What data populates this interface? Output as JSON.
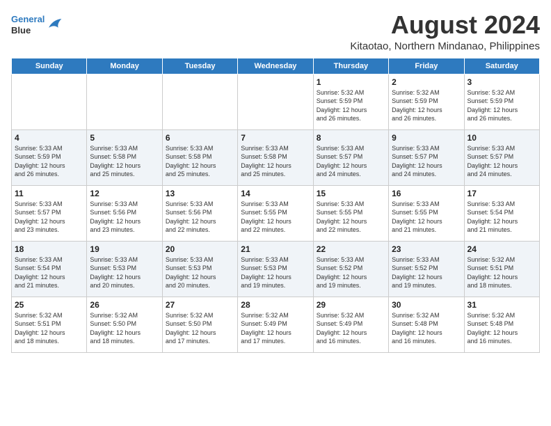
{
  "logo": {
    "line1": "General",
    "line2": "Blue"
  },
  "title": "August 2024",
  "subtitle": "Kitaotao, Northern Mindanao, Philippines",
  "days_of_week": [
    "Sunday",
    "Monday",
    "Tuesday",
    "Wednesday",
    "Thursday",
    "Friday",
    "Saturday"
  ],
  "weeks": [
    [
      {
        "day": "",
        "info": ""
      },
      {
        "day": "",
        "info": ""
      },
      {
        "day": "",
        "info": ""
      },
      {
        "day": "",
        "info": ""
      },
      {
        "day": "1",
        "info": "Sunrise: 5:32 AM\nSunset: 5:59 PM\nDaylight: 12 hours\nand 26 minutes."
      },
      {
        "day": "2",
        "info": "Sunrise: 5:32 AM\nSunset: 5:59 PM\nDaylight: 12 hours\nand 26 minutes."
      },
      {
        "day": "3",
        "info": "Sunrise: 5:32 AM\nSunset: 5:59 PM\nDaylight: 12 hours\nand 26 minutes."
      }
    ],
    [
      {
        "day": "4",
        "info": "Sunrise: 5:33 AM\nSunset: 5:59 PM\nDaylight: 12 hours\nand 26 minutes."
      },
      {
        "day": "5",
        "info": "Sunrise: 5:33 AM\nSunset: 5:58 PM\nDaylight: 12 hours\nand 25 minutes."
      },
      {
        "day": "6",
        "info": "Sunrise: 5:33 AM\nSunset: 5:58 PM\nDaylight: 12 hours\nand 25 minutes."
      },
      {
        "day": "7",
        "info": "Sunrise: 5:33 AM\nSunset: 5:58 PM\nDaylight: 12 hours\nand 25 minutes."
      },
      {
        "day": "8",
        "info": "Sunrise: 5:33 AM\nSunset: 5:57 PM\nDaylight: 12 hours\nand 24 minutes."
      },
      {
        "day": "9",
        "info": "Sunrise: 5:33 AM\nSunset: 5:57 PM\nDaylight: 12 hours\nand 24 minutes."
      },
      {
        "day": "10",
        "info": "Sunrise: 5:33 AM\nSunset: 5:57 PM\nDaylight: 12 hours\nand 24 minutes."
      }
    ],
    [
      {
        "day": "11",
        "info": "Sunrise: 5:33 AM\nSunset: 5:57 PM\nDaylight: 12 hours\nand 23 minutes."
      },
      {
        "day": "12",
        "info": "Sunrise: 5:33 AM\nSunset: 5:56 PM\nDaylight: 12 hours\nand 23 minutes."
      },
      {
        "day": "13",
        "info": "Sunrise: 5:33 AM\nSunset: 5:56 PM\nDaylight: 12 hours\nand 22 minutes."
      },
      {
        "day": "14",
        "info": "Sunrise: 5:33 AM\nSunset: 5:55 PM\nDaylight: 12 hours\nand 22 minutes."
      },
      {
        "day": "15",
        "info": "Sunrise: 5:33 AM\nSunset: 5:55 PM\nDaylight: 12 hours\nand 22 minutes."
      },
      {
        "day": "16",
        "info": "Sunrise: 5:33 AM\nSunset: 5:55 PM\nDaylight: 12 hours\nand 21 minutes."
      },
      {
        "day": "17",
        "info": "Sunrise: 5:33 AM\nSunset: 5:54 PM\nDaylight: 12 hours\nand 21 minutes."
      }
    ],
    [
      {
        "day": "18",
        "info": "Sunrise: 5:33 AM\nSunset: 5:54 PM\nDaylight: 12 hours\nand 21 minutes."
      },
      {
        "day": "19",
        "info": "Sunrise: 5:33 AM\nSunset: 5:53 PM\nDaylight: 12 hours\nand 20 minutes."
      },
      {
        "day": "20",
        "info": "Sunrise: 5:33 AM\nSunset: 5:53 PM\nDaylight: 12 hours\nand 20 minutes."
      },
      {
        "day": "21",
        "info": "Sunrise: 5:33 AM\nSunset: 5:53 PM\nDaylight: 12 hours\nand 19 minutes."
      },
      {
        "day": "22",
        "info": "Sunrise: 5:33 AM\nSunset: 5:52 PM\nDaylight: 12 hours\nand 19 minutes."
      },
      {
        "day": "23",
        "info": "Sunrise: 5:33 AM\nSunset: 5:52 PM\nDaylight: 12 hours\nand 19 minutes."
      },
      {
        "day": "24",
        "info": "Sunrise: 5:32 AM\nSunset: 5:51 PM\nDaylight: 12 hours\nand 18 minutes."
      }
    ],
    [
      {
        "day": "25",
        "info": "Sunrise: 5:32 AM\nSunset: 5:51 PM\nDaylight: 12 hours\nand 18 minutes."
      },
      {
        "day": "26",
        "info": "Sunrise: 5:32 AM\nSunset: 5:50 PM\nDaylight: 12 hours\nand 18 minutes."
      },
      {
        "day": "27",
        "info": "Sunrise: 5:32 AM\nSunset: 5:50 PM\nDaylight: 12 hours\nand 17 minutes."
      },
      {
        "day": "28",
        "info": "Sunrise: 5:32 AM\nSunset: 5:49 PM\nDaylight: 12 hours\nand 17 minutes."
      },
      {
        "day": "29",
        "info": "Sunrise: 5:32 AM\nSunset: 5:49 PM\nDaylight: 12 hours\nand 16 minutes."
      },
      {
        "day": "30",
        "info": "Sunrise: 5:32 AM\nSunset: 5:48 PM\nDaylight: 12 hours\nand 16 minutes."
      },
      {
        "day": "31",
        "info": "Sunrise: 5:32 AM\nSunset: 5:48 PM\nDaylight: 12 hours\nand 16 minutes."
      }
    ]
  ]
}
